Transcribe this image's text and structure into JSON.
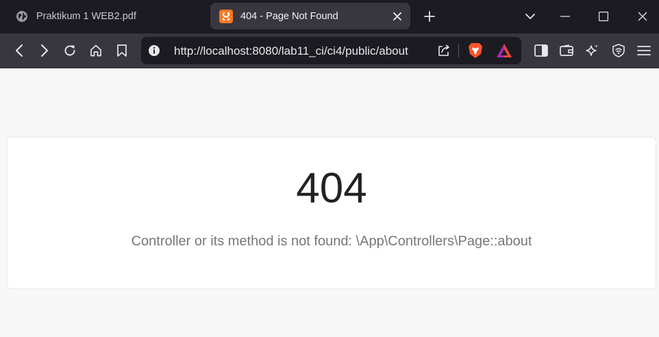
{
  "browser": {
    "tabs": [
      {
        "title": "Praktikum 1 WEB2.pdf",
        "icon": "globe-icon",
        "active": false
      },
      {
        "title": "404 - Page Not Found",
        "icon": "xampp-favicon-icon",
        "active": true
      }
    ],
    "address_bar": {
      "url": "http://localhost:8080/lab11_ci/ci4/public/about"
    },
    "colors": {
      "tabstrip_bg": "#1c1b22",
      "toolbar_bg": "#38373f",
      "brave_orange": "#fb542b",
      "xampp_orange": "#fb7a24"
    }
  },
  "page": {
    "error_code": "404",
    "error_message": "Controller or its method is not found: \\App\\Controllers\\Page::about",
    "colors": {
      "background": "#f7f7f7",
      "card": "#ffffff",
      "code_text": "#222222",
      "message_text": "#777777"
    }
  }
}
